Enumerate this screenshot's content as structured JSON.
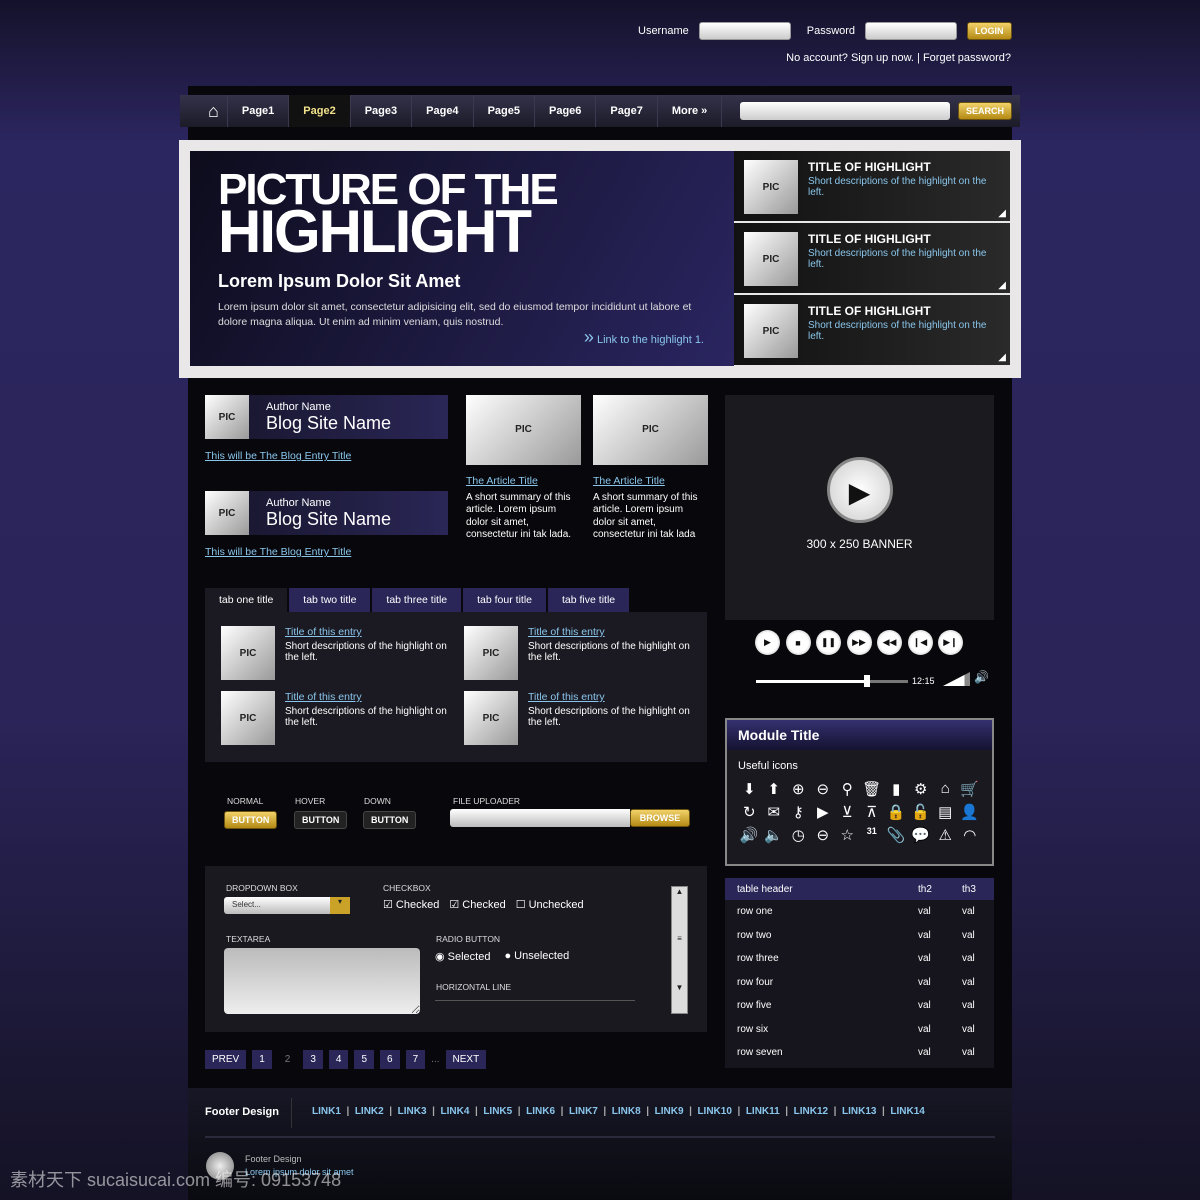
{
  "login": {
    "username_label": "Username",
    "password_label": "Password",
    "login_button": "LOGIN",
    "signup": "No account? Sign up now.",
    "forgot": "Forget password?",
    "separator": "|"
  },
  "nav": {
    "items": [
      "Page1",
      "Page2",
      "Page3",
      "Page4",
      "Page5",
      "Page6",
      "Page7"
    ],
    "active": "Page2",
    "more": "More",
    "search_button": "SEARCH"
  },
  "hero": {
    "title_line1": "PICTURE OF THE",
    "title_line2": "HIGHLIGHT",
    "subtitle": "Lorem Ipsum Dolor Sit Amet",
    "body": "Lorem ipsum dolor sit amet, consectetur adipisicing elit, sed do eiusmod tempor incididunt ut labore et dolore magna aliqua. Ut enim ad minim veniam, quis nostrud.",
    "link": "Link to the highlight 1."
  },
  "highlights": [
    {
      "pic": "PIC",
      "title": "TITLE OF HIGHLIGHT",
      "desc": "Short descriptions of the highlight on the left."
    },
    {
      "pic": "PIC",
      "title": "TITLE OF HIGHLIGHT",
      "desc": "Short descriptions of the highlight on the left."
    },
    {
      "pic": "PIC",
      "title": "TITLE OF HIGHLIGHT",
      "desc": "Short descriptions of the highlight on the left."
    }
  ],
  "blogs": [
    {
      "pic": "PIC",
      "author": "Author Name",
      "site": "Blog Site Name",
      "entry": "This will be The Blog Entry Title"
    },
    {
      "pic": "PIC",
      "author": "Author Name",
      "site": "Blog Site Name",
      "entry": "This will be The Blog Entry Title"
    }
  ],
  "articles": [
    {
      "pic": "PIC",
      "title": "The Article Title",
      "summary": "A short summary of this article. Lorem ipsum dolor sit amet, consectetur ini tak lada."
    },
    {
      "pic": "PIC",
      "title": "The Article Title",
      "summary": "A short summary of this article. Lorem ipsum dolor sit amet, consectetur ini tak lada"
    }
  ],
  "banner": {
    "label": "300 x 250 BANNER",
    "time": "12:15",
    "progress": 0.73,
    "volume": 0.8
  },
  "player_controls": [
    "play",
    "stop",
    "pause",
    "fast-forward",
    "rewind",
    "skip-back",
    "skip-forward"
  ],
  "tabs": [
    "tab one title",
    "tab two title",
    "tab three title",
    "tab four title",
    "tab five title"
  ],
  "entries": [
    {
      "pic": "PIC",
      "title": "Title of this entry",
      "desc": "Short descriptions of the highlight on the left."
    },
    {
      "pic": "PIC",
      "title": "Title of this entry",
      "desc": "Short descriptions of the highlight on the left."
    },
    {
      "pic": "PIC",
      "title": "Title of this entry",
      "desc": "Short descriptions of the highlight on the left."
    },
    {
      "pic": "PIC",
      "title": "Title of this entry",
      "desc": "Short descriptions of the highlight on the left."
    }
  ],
  "buttons": {
    "normal_label": "NORMAL",
    "hover_label": "HOVER",
    "down_label": "DOWN",
    "button": "BUTTON",
    "file_label": "FILE UPLOADER",
    "browse": "BROWSE"
  },
  "form": {
    "dropdown_label": "DROPDOWN BOX",
    "dropdown_value": "Select...",
    "checkbox_label": "CHECKBOX",
    "checked1": "Checked",
    "checked2": "Checked",
    "unchecked": "Unchecked",
    "textarea_label": "TEXTAREA",
    "radio_label": "RADIO BUTTON",
    "selected": "Selected",
    "unselected": "Unselected",
    "hline_label": "HORIZONTAL LINE"
  },
  "pagination": {
    "prev": "PREV",
    "pages": [
      "1",
      "2",
      "3",
      "4",
      "5",
      "6",
      "7"
    ],
    "current": "2",
    "ellipsis": "...",
    "next": "NEXT"
  },
  "module": {
    "title": "Module Title",
    "subtitle": "Useful icons",
    "icons": [
      [
        "arrow-down",
        "⬇"
      ],
      [
        "arrow-up",
        "⬆"
      ],
      [
        "zoom-in",
        "⊕"
      ],
      [
        "zoom-out",
        "⊖"
      ],
      [
        "search",
        "⚲"
      ],
      [
        "trash",
        "🗑"
      ],
      [
        "bar-chart",
        "▮"
      ],
      [
        "gear",
        "⚙"
      ],
      [
        "home",
        "⌂"
      ],
      [
        "cart",
        "🛒"
      ],
      [
        "refresh",
        "↻"
      ],
      [
        "mail",
        "✉"
      ],
      [
        "key",
        "⚷"
      ],
      [
        "play-circle",
        "▶"
      ],
      [
        "chevron-down-box",
        "⊻"
      ],
      [
        "chevron-up-box",
        "⊼"
      ],
      [
        "lock",
        "🔒"
      ],
      [
        "unlock",
        "🔓"
      ],
      [
        "document",
        "▤"
      ],
      [
        "user",
        "👤"
      ],
      [
        "volume",
        "🔊"
      ],
      [
        "mute",
        "🔈"
      ],
      [
        "clock",
        "◷"
      ],
      [
        "minus-circle",
        "⊖"
      ],
      [
        "star",
        "☆"
      ],
      [
        "calendar",
        "31"
      ],
      [
        "paperclip",
        "📎"
      ],
      [
        "speech-bubble",
        "💬"
      ],
      [
        "warning",
        "⚠"
      ],
      [
        "rss",
        "◠"
      ]
    ]
  },
  "table": {
    "headers": [
      "table header",
      "th2",
      "th3"
    ],
    "rows": [
      [
        "row one",
        "val",
        "val"
      ],
      [
        "row two",
        "val",
        "val"
      ],
      [
        "row three",
        "val",
        "val"
      ],
      [
        "row four",
        "val",
        "val"
      ],
      [
        "row five",
        "val",
        "val"
      ],
      [
        "row six",
        "val",
        "val"
      ],
      [
        "row seven",
        "val",
        "val"
      ]
    ]
  },
  "footer": {
    "title": "Footer Design",
    "links": [
      "LINK1",
      "LINK2",
      "LINK3",
      "LINK4",
      "LINK5",
      "LINK6",
      "LINK7",
      "LINK8",
      "LINK9",
      "LINK10",
      "LINK11",
      "LINK12",
      "LINK13",
      "LINK14"
    ],
    "small_title": "Footer Design",
    "small_text": "Lorem ipsum dolor sit amet"
  },
  "watermark": "素材天下 sucaisucai.com  编号: 09153748"
}
